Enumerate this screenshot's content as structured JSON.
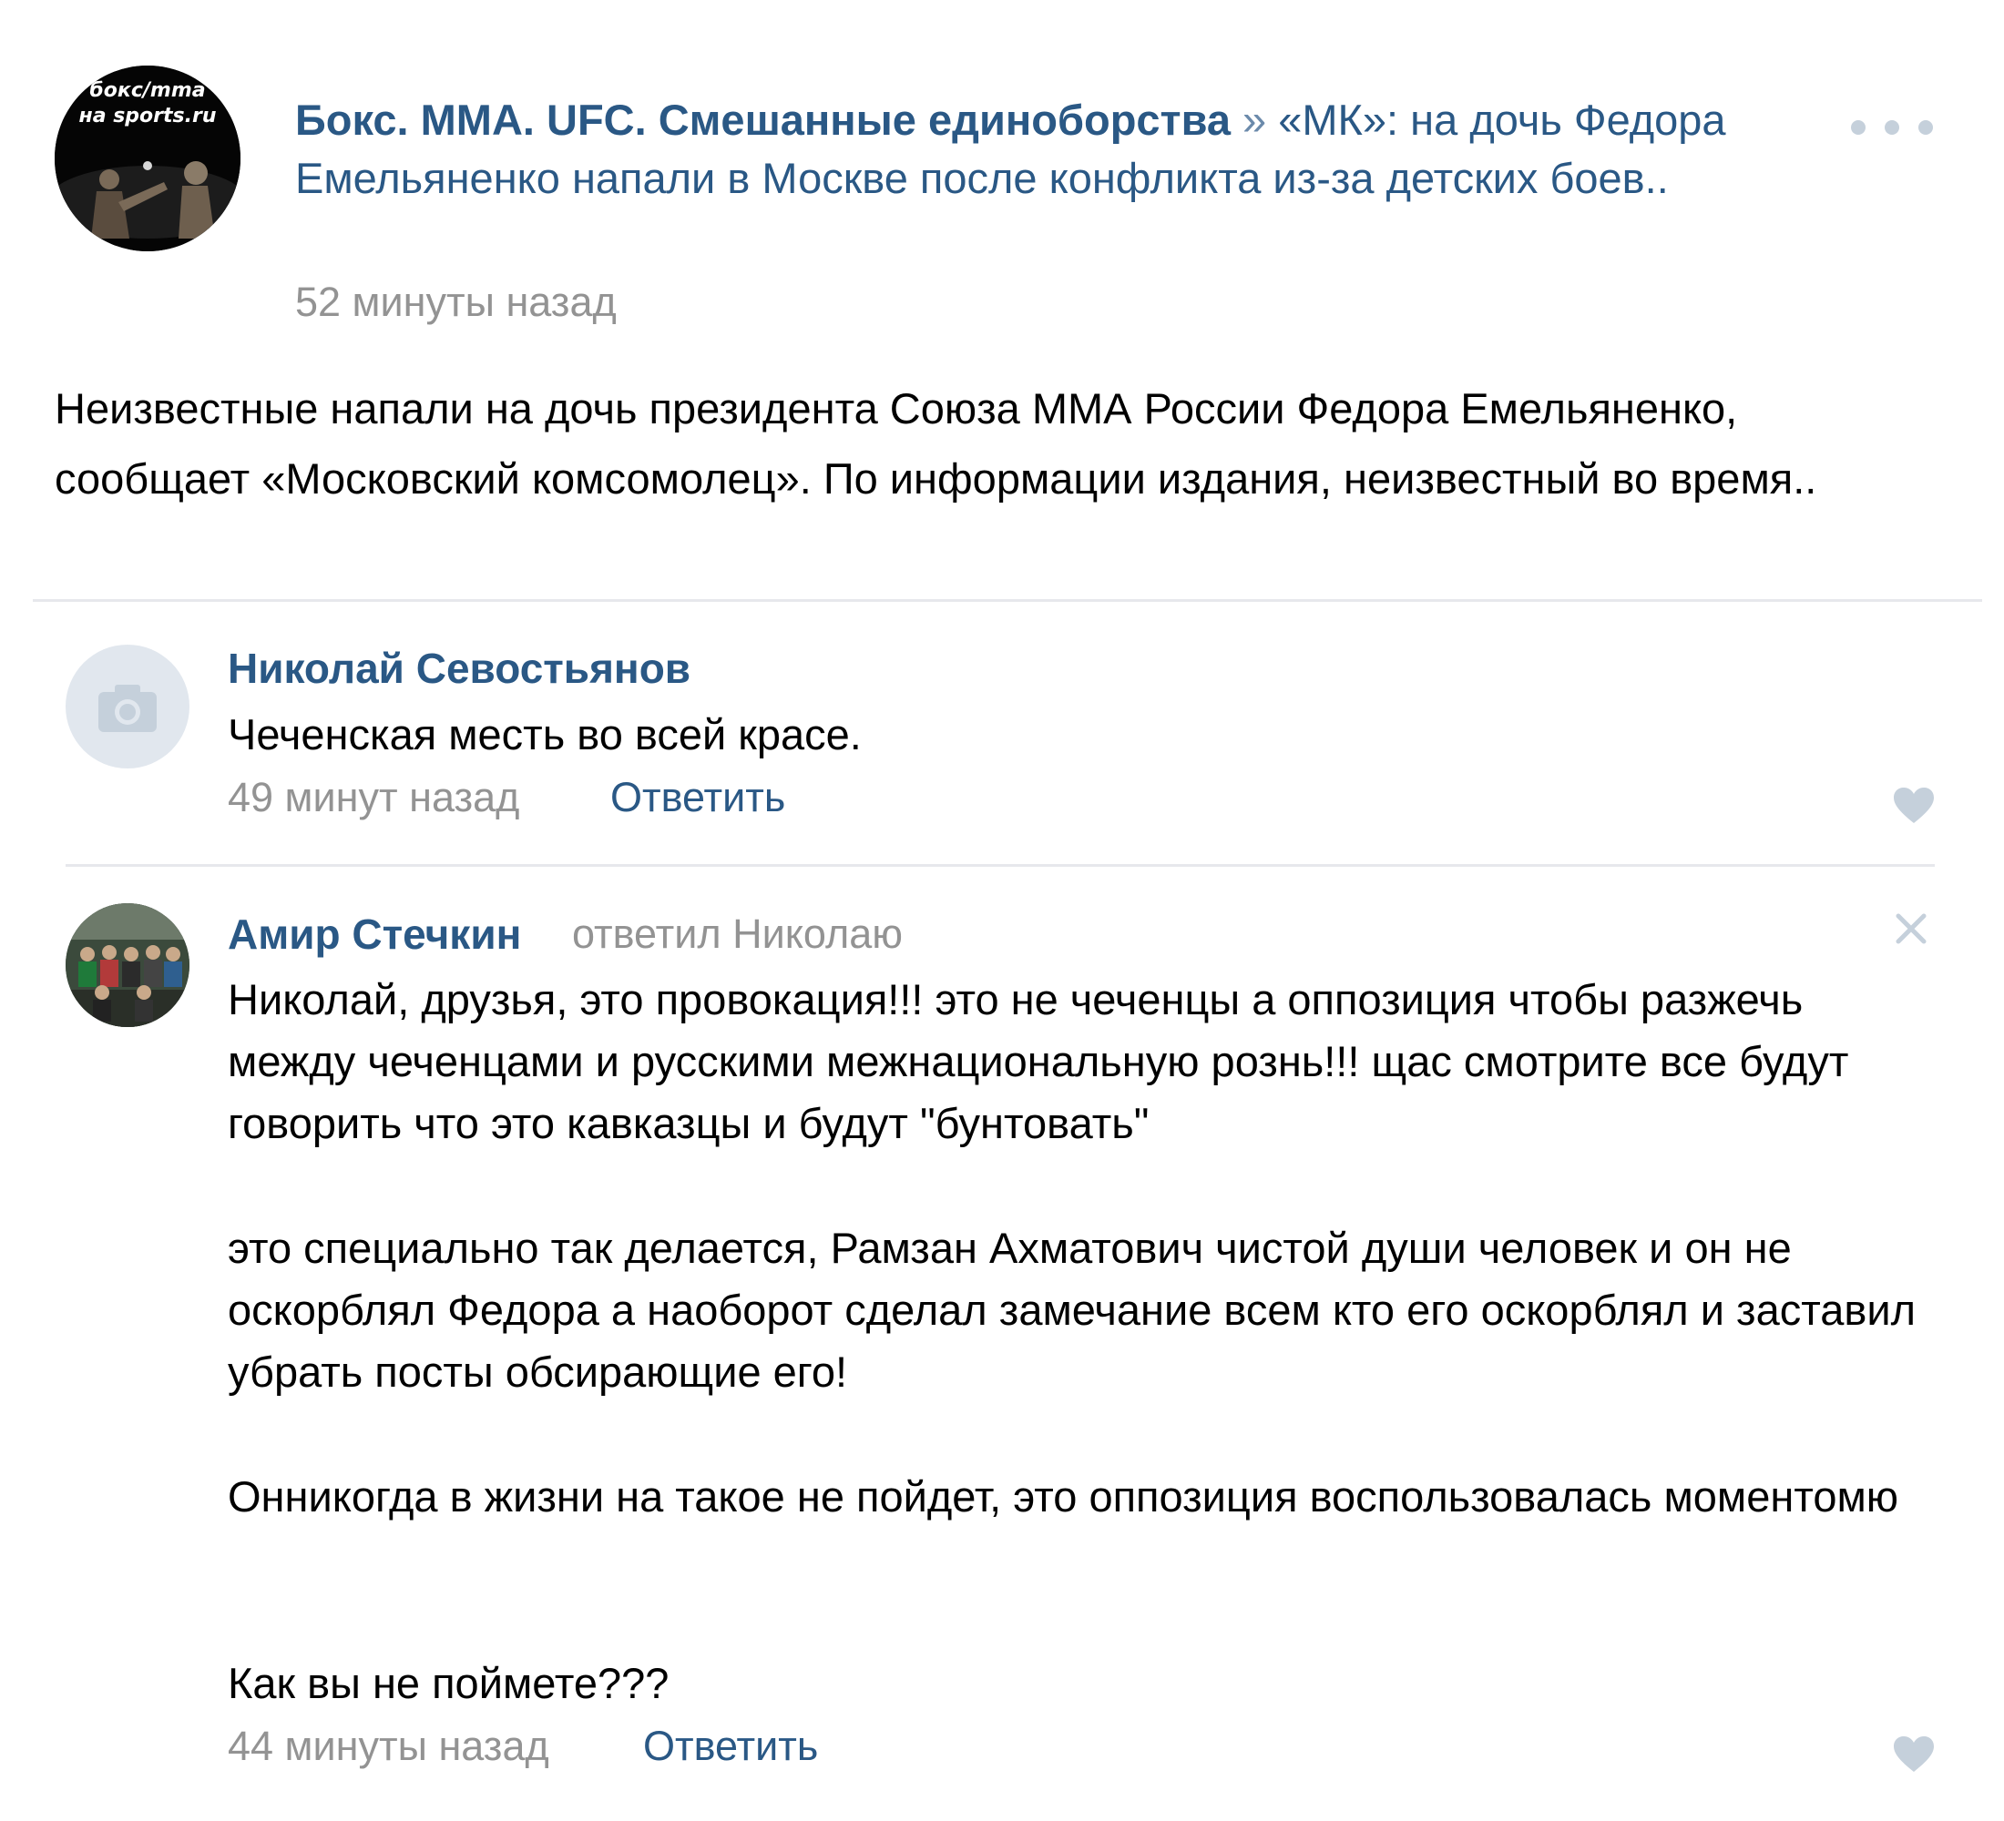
{
  "post": {
    "group_logo_text_line1": "бокс/mma",
    "group_logo_text_line2": "на sports.ru",
    "group_name": "Бокс. MMA. UFC. Смешанные единоборства",
    "separator": " » ",
    "headline": "«МК»: на дочь Федора Емельяненко напали в Москве после конфликта из-за детских боев..",
    "time": "52 минуты назад",
    "menu_icon": "more-horizontal-icon",
    "body": "Неизвестные напали на дочь президента Союза ММА России Федора Емельяненко, сообщает «Московский комсомолец». По информации издания, неизвестный во время.."
  },
  "comments": [
    {
      "author": "Николай Севостьянов",
      "text": "Чеченская месть во всей красе.",
      "time": "49 минут назад",
      "reply_label": "Ответить",
      "avatar_icon": "camera-icon",
      "like_icon": "heart-icon"
    },
    {
      "author": "Амир Стечкин",
      "reply_to": "ответил Николаю",
      "paragraphs": [
        "Николай, друзья, это провокация!!! это не чеченцы а оппозиция чтобы разжечь между чеченцами и русскими межнациональную рознь!!! щас смотрите все будут говорить что это кавказцы и будут \"бунтовать\"",
        "это специально так делается, Рамзан Ахматович чистой души человек и он не оскорблял Федора а наоборот сделал замечание всем кто его оскорблял и заставил убрать посты обсирающие его!",
        "Онникогда в жизни на такое не пойдет, это оппозиция воспользовалась моментомю",
        "Как вы не поймете???"
      ],
      "time": "44 минуты назад",
      "reply_label": "Ответить",
      "like_icon": "heart-icon",
      "close_icon": "close-icon"
    }
  ],
  "colors": {
    "link": "#2a5885",
    "meta": "#939393",
    "divider": "#e7e8ec",
    "icon": "#c5d0db"
  }
}
